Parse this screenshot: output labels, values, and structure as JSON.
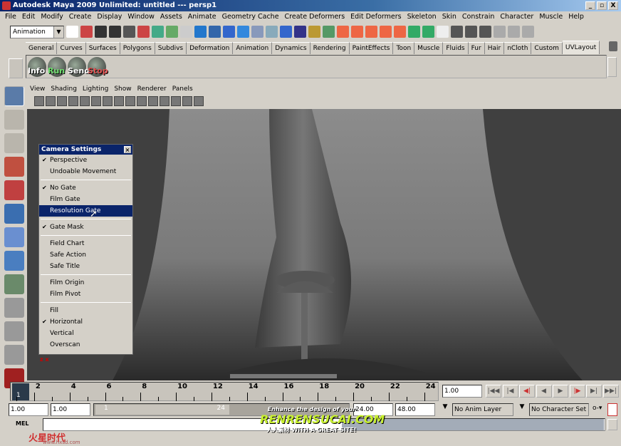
{
  "window": {
    "title": "Autodesk Maya 2009 Unlimited: untitled   ---   persp1",
    "minimize": "_",
    "maximize": "▫",
    "close": "X"
  },
  "menu": [
    "File",
    "Edit",
    "Modify",
    "Create",
    "Display",
    "Window",
    "Assets",
    "Animate",
    "Geometry Cache",
    "Create Deformers",
    "Edit Deformers",
    "Skeleton",
    "Skin",
    "Constrain",
    "Character",
    "Muscle",
    "Help"
  ],
  "statusline": {
    "menuset": "Animation"
  },
  "shelf": {
    "tabs": [
      "General",
      "Curves",
      "Surfaces",
      "Polygons",
      "Subdivs",
      "Deformation",
      "Animation",
      "Dynamics",
      "Rendering",
      "PaintEffects",
      "Toon",
      "Muscle",
      "Fluids",
      "Fur",
      "Hair",
      "nCloth",
      "Custom",
      "UVLayout"
    ],
    "active": "UVLayout",
    "buttons": [
      {
        "label": "Info",
        "color": "#ffffff"
      },
      {
        "label": "Run",
        "color": "#6fe06f"
      },
      {
        "label": "Send",
        "color": "#ffffff"
      },
      {
        "label": "Stop",
        "color": "#e05050"
      }
    ]
  },
  "panel": {
    "menu": [
      "View",
      "Shading",
      "Lighting",
      "Show",
      "Renderer",
      "Panels"
    ]
  },
  "camera_settings": {
    "title": "Camera Settings",
    "groups": [
      [
        {
          "label": "Perspective",
          "checked": true
        },
        {
          "label": "Undoable Movement",
          "checked": false
        }
      ],
      [
        {
          "label": "No Gate",
          "checked": true
        },
        {
          "label": "Film Gate",
          "checked": false
        },
        {
          "label": "Resolution Gate",
          "checked": false,
          "highlighted": true
        }
      ],
      [
        {
          "label": "Gate Mask",
          "checked": true
        }
      ],
      [
        {
          "label": "Field Chart",
          "checked": false
        },
        {
          "label": "Safe Action",
          "checked": false
        },
        {
          "label": "Safe Title",
          "checked": false
        }
      ],
      [
        {
          "label": "Film Origin",
          "checked": false
        },
        {
          "label": "Film Pivot",
          "checked": false
        }
      ],
      [
        {
          "label": "Fill",
          "checked": false
        },
        {
          "label": "Horizontal",
          "checked": true
        },
        {
          "label": "Vertical",
          "checked": false
        },
        {
          "label": "Overscan",
          "checked": false
        }
      ]
    ]
  },
  "timeline": {
    "ticks": [
      "2",
      "4",
      "6",
      "8",
      "10",
      "12",
      "14",
      "16",
      "18",
      "20",
      "22",
      "24"
    ],
    "current_frame": "1",
    "current_time": "1.00"
  },
  "range": {
    "start_anim": "1.00",
    "start": "1.00",
    "slider_start": "1",
    "slider_end": "24",
    "end": "24.00",
    "end_anim": "48.00",
    "anim_layer": "No Anim Layer",
    "character_set": "No Character Set"
  },
  "command": {
    "label": "MEL"
  },
  "watermark": {
    "line1": "Enhance the design of your",
    "line2": "RENRENSUCAI.COM",
    "line3": "人人素材 WITH A GREAT SITE!",
    "logo": "火星时代",
    "url": "www.hxsd.com"
  },
  "colors": {
    "title": "#0a246a",
    "highlight": "#0a246a",
    "panel": "#d4d0c8"
  }
}
